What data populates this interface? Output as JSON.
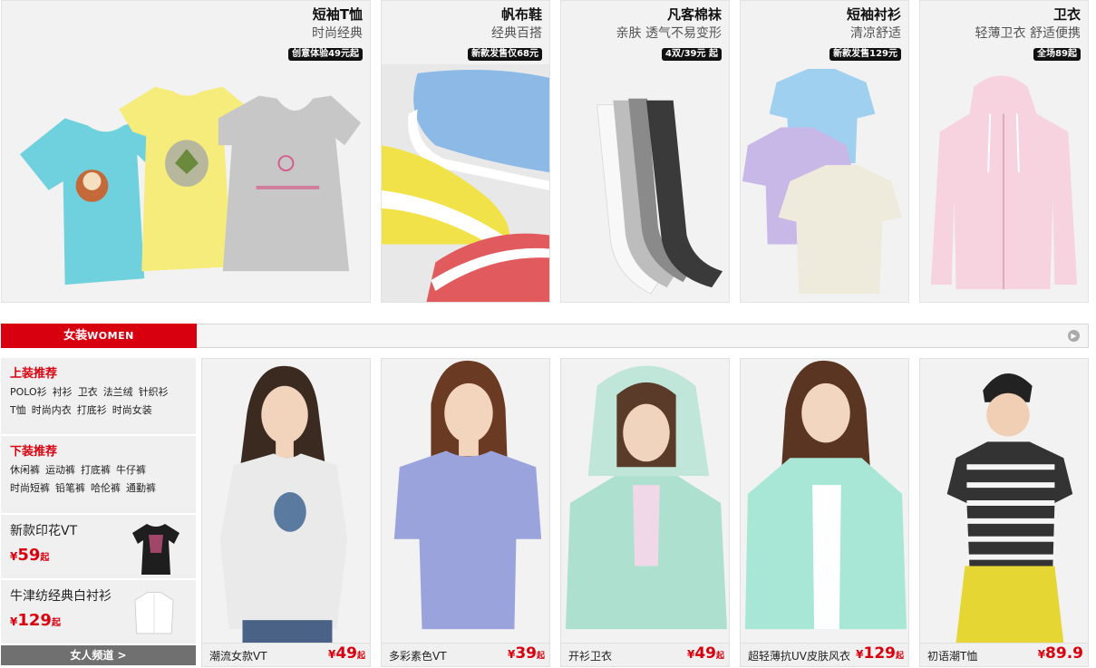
{
  "promos": [
    {
      "title": "短袖T恤",
      "sub": "时尚经典",
      "badge": "创意体验49元起",
      "icon": "tshirts-image"
    },
    {
      "title": "帆布鞋",
      "sub": "经典百搭",
      "badge": "新款发售仅68元",
      "icon": "canvas-shoes-image"
    },
    {
      "title": "凡客棉袜",
      "sub": "亲肤  透气不易变形",
      "badge": "4双/39元 起",
      "icon": "socks-image"
    },
    {
      "title": "短袖衬衫",
      "sub": "清凉舒适",
      "badge": "新款发售129元",
      "icon": "shirts-image"
    },
    {
      "title": "卫衣",
      "sub": "轻薄卫衣 舒适便携",
      "badge": "全场89起",
      "icon": "hoodie-image"
    }
  ],
  "category": {
    "label_cn": "女装",
    "label_en": "WOMEN",
    "more_icon": "arrow-right-icon"
  },
  "side": {
    "tops": {
      "heading": "上装推荐",
      "links": [
        "POLO衫",
        "衬衫",
        "卫衣",
        "法兰绒",
        "针织衫",
        "T恤",
        "时尚内衣",
        "打底衫",
        "时尚女装"
      ]
    },
    "bottoms": {
      "heading": "下装推荐",
      "links": [
        "休闲裤",
        "运动裤",
        "打底裤",
        "牛仔裤",
        "时尚短裤",
        "铅笔裤",
        "哈伦裤",
        "通勤裤"
      ]
    },
    "promo1": {
      "name": "新款印花VT",
      "yen": "¥",
      "price": "59",
      "qi": "起"
    },
    "promo2": {
      "name": "牛津纺经典白衬衫",
      "yen": "¥",
      "price": "129",
      "qi": "起"
    },
    "channel": "女人频道 >"
  },
  "products": [
    {
      "name": "潮流女款VT",
      "yen": "¥",
      "price": "49",
      "qi": "起"
    },
    {
      "name": "多彩素色VT",
      "yen": "¥",
      "price": "39",
      "qi": "起"
    },
    {
      "name": "开衫卫衣",
      "yen": "¥",
      "price": "49",
      "qi": "起"
    },
    {
      "name": "超轻薄抗UV皮肤风衣",
      "yen": "¥",
      "price": "129",
      "qi": "起"
    },
    {
      "name": "初语潮T恤",
      "yen": "¥",
      "price": "89.9",
      "qi": ""
    }
  ],
  "colors": {
    "accent": "#d8000f",
    "channel_bg": "#707070"
  }
}
